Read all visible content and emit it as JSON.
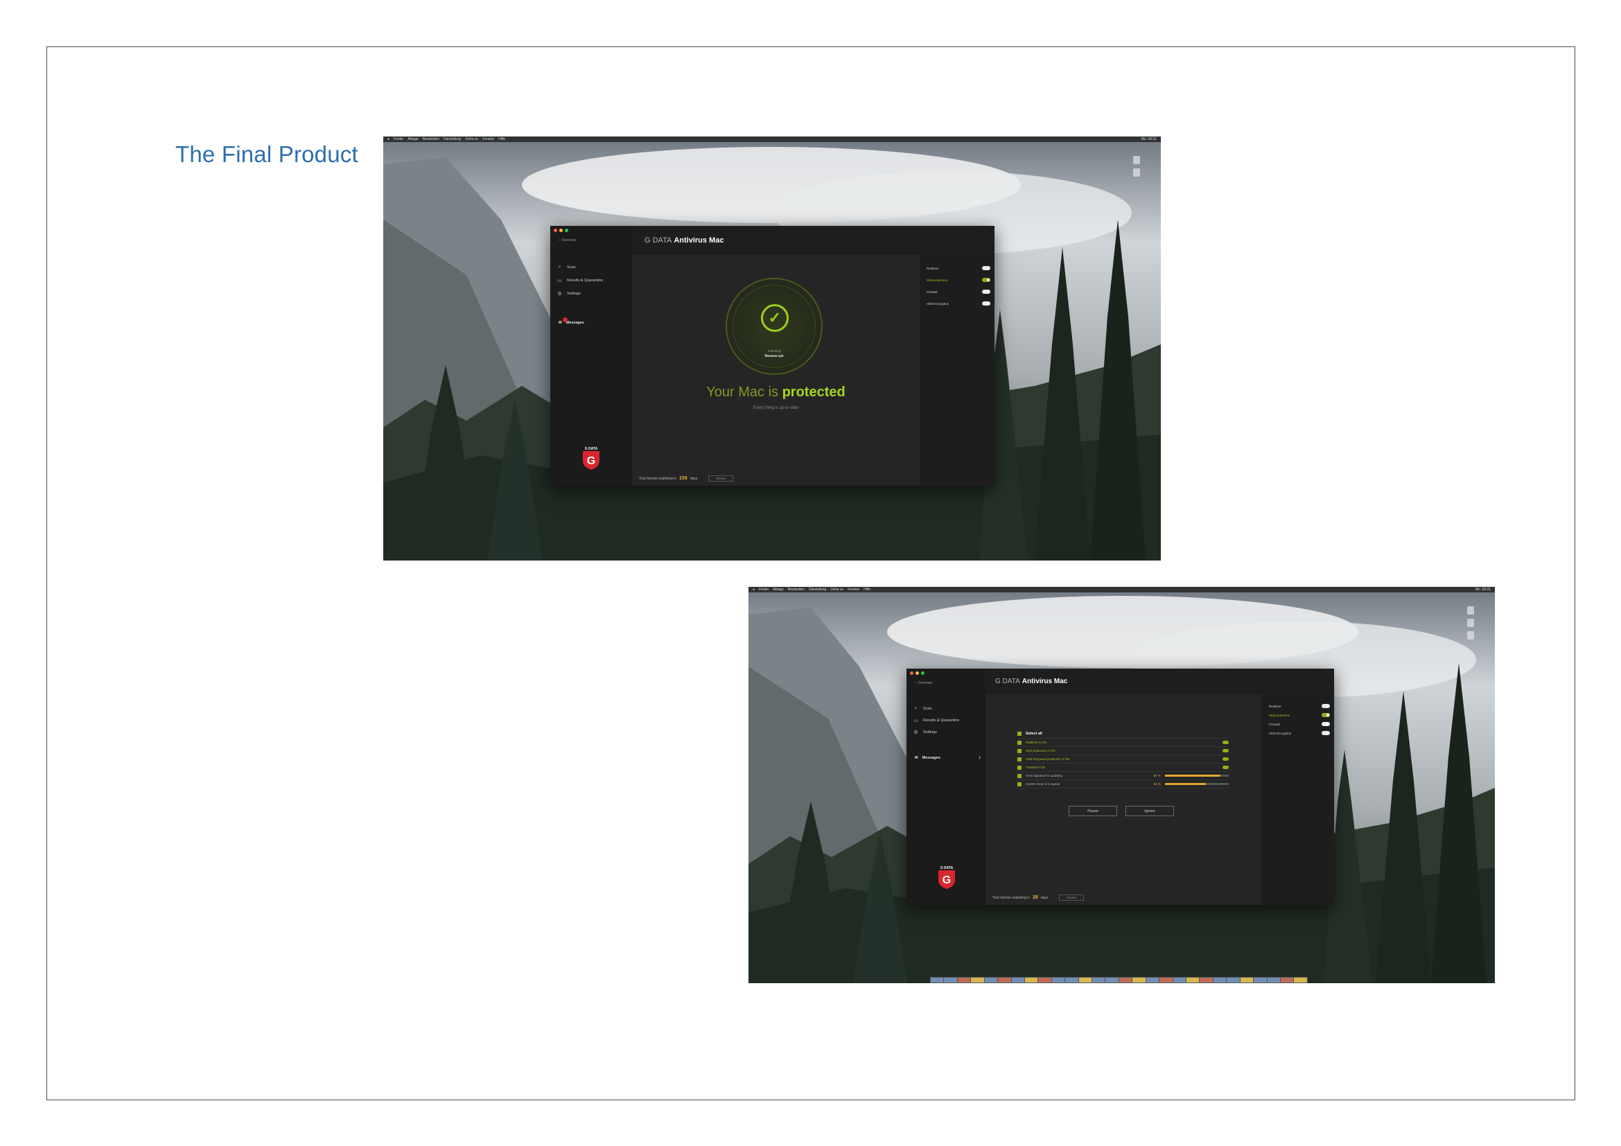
{
  "page": {
    "title": "The Final Product"
  },
  "colors": {
    "title_blue": "#2e6fad",
    "accent_green": "#a3c31f",
    "license_days": "#e6b63b",
    "progress": "#e6a530"
  },
  "os": {
    "menubar_left": [
      "Finder",
      "Ablage",
      "Bearbeiten",
      "Darstellung",
      "Gehe zu",
      "Fenster",
      "Hilfe"
    ],
    "menubar_clock": "Mo. 09:31"
  },
  "app": {
    "brand": "G DATA",
    "name": "Antivirus Mac",
    "back_label": "Overview",
    "nav": [
      {
        "label": "Scan",
        "icon": "search-icon"
      },
      {
        "label": "Results & Quarantine",
        "icon": "folder-icon"
      },
      {
        "label": "Settings",
        "icon": "gear-icon"
      }
    ],
    "messages_label": "Messages",
    "messages_count": "1",
    "toggles": [
      {
        "label": "Realtime",
        "on": false
      },
      {
        "label": "Web protection",
        "on": true,
        "accent": true
      },
      {
        "label": "Firewall",
        "on": false
      },
      {
        "label": "HDD Encryption",
        "on": false
      }
    ],
    "logo_text": "G DATA"
  },
  "screen1": {
    "scanning_label": "Scanning",
    "scanning_file": "filename.xyh",
    "status_prefix": "Your Mac is",
    "status_word": "protected",
    "status_sub": "Every thing is up-to-date",
    "license_prefix": "Your license expireing in",
    "license_days": "156",
    "license_suffix": "days",
    "renew_label": "Renew"
  },
  "screen2": {
    "select_all": "Select all",
    "rows": [
      {
        "label": "Realtime is ON",
        "type": "toggle"
      },
      {
        "label": "Web protection is ON",
        "type": "toggle"
      },
      {
        "label": "USB Keyguard protection is ON",
        "type": "toggle"
      },
      {
        "label": "Firewall is ON",
        "type": "toggle"
      },
      {
        "label": "Virus signature is updating",
        "type": "progress",
        "percent": 87,
        "percent_label": "87 %"
      },
      {
        "label": "System Scan is in queue",
        "type": "progress",
        "percent": 64,
        "percent_label": "64 %"
      }
    ],
    "pause_label": "Pause",
    "ignore_label": "Ignore",
    "license_prefix": "Your license expireing in",
    "license_days": "28",
    "license_suffix": "days",
    "renew_label": "Renew"
  }
}
